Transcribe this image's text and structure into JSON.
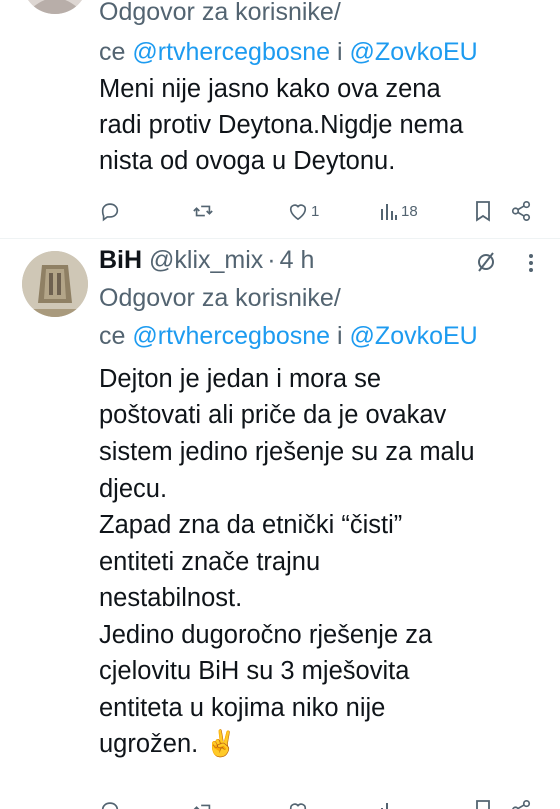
{
  "tweet1": {
    "reply_prefix": "Odgovor za korisnike/",
    "reply_prefix2": "ce",
    "mention1": "@rtvhercegbosne",
    "and_word": "i",
    "mention2": "@ZovkoEU",
    "text_lines": [
      "Meni nije jasno kako ova zena",
      "radi protiv Deytona.Nigdje nema",
      "nista od ovoga u Deytonu."
    ],
    "like_count": "1",
    "view_count": "18"
  },
  "tweet2": {
    "display_name": "BiH",
    "handle": "@klix_mix",
    "separator": "·",
    "time": "4 h",
    "reply_prefix": "Odgovor za korisnike/",
    "reply_prefix2": "ce",
    "mention1": "@rtvhercegbosne",
    "and_word": "i",
    "mention2": "@ZovkoEU",
    "text_lines": [
      "Dejton je jedan i mora se",
      "poštovati  ali priče da je ovakav",
      "sistem jedino rješenje su za malu",
      "djecu.",
      "Zapad zna da etnički “čisti”",
      "entiteti znače trajnu",
      "nestabilnost.",
      "Jedino dugoročno rješenje za",
      "cjelovitu BiH su 3 mješovita",
      "entiteta u kojima niko nije",
      "ugrožen. ✌"
    ]
  },
  "icons": {
    "reply": "reply-icon",
    "retweet": "retweet-icon",
    "like": "heart-icon",
    "views": "views-icon",
    "bookmark": "bookmark-icon",
    "share": "share-icon",
    "grok": "grok-icon",
    "more": "more-icon"
  },
  "colors": {
    "link": "#1d9bf0",
    "secondary": "#536471",
    "text": "#0f1419",
    "divider": "#eff3f4"
  }
}
